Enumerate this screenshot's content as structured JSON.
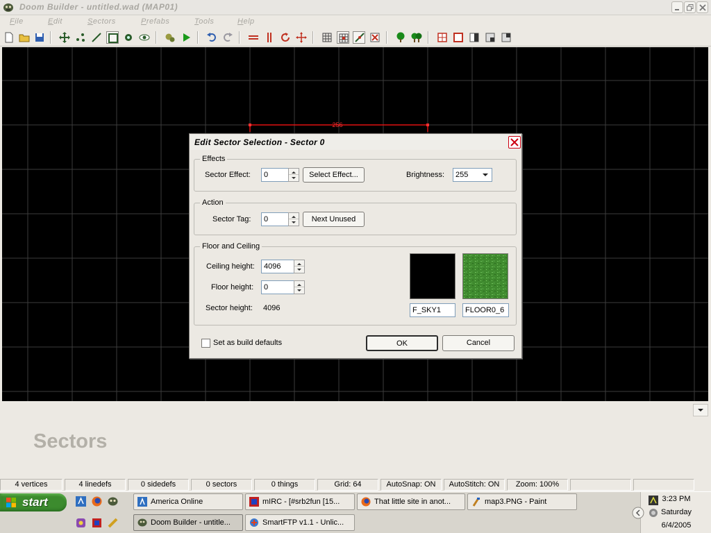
{
  "window": {
    "title": "Doom Builder - untitled.wad (MAP01)"
  },
  "menu": [
    {
      "u": "F",
      "rest": "ile"
    },
    {
      "u": "E",
      "rest": "dit"
    },
    {
      "u": "S",
      "rest": "ectors"
    },
    {
      "u": "P",
      "rest": "refabs"
    },
    {
      "u": "T",
      "rest": "ools"
    },
    {
      "u": "H",
      "rest": "elp"
    }
  ],
  "map": {
    "line_length_label": "256"
  },
  "dialog": {
    "title": "Edit Sector Selection - Sector 0",
    "effects": {
      "legend": "Effects",
      "sector_effect_label": "Sector Effect:",
      "sector_effect_value": "0",
      "select_effect_button": "Select Effect...",
      "brightness_label": "Brightness:",
      "brightness_value": "255"
    },
    "action": {
      "legend": "Action",
      "sector_tag_label": "Sector Tag:",
      "sector_tag_value": "0",
      "next_unused_button": "Next Unused"
    },
    "floor_ceiling": {
      "legend": "Floor and Ceiling",
      "ceiling_height_label": "Ceiling height:",
      "ceiling_height_value": "4096",
      "floor_height_label": "Floor height:",
      "floor_height_value": "0",
      "sector_height_label": "Sector height:",
      "sector_height_value": "4096",
      "ceiling_texture": "F_SKY1",
      "floor_texture": "FLOOR0_6"
    },
    "build_defaults_label": "Set as build defaults",
    "ok_button": "OK",
    "cancel_button": "Cancel"
  },
  "info_panel": {
    "title": "Sectors"
  },
  "status": {
    "vertices": "4 vertices",
    "linedefs": "4 linedefs",
    "sidedefs": "0 sidedefs",
    "sectors": "0 sectors",
    "things": "0 things",
    "grid": "Grid: 64",
    "autosnap": "AutoSnap: ON",
    "autostitch": "AutoStitch: ON",
    "zoom": "Zoom: 100%"
  },
  "taskbar": {
    "start": "start",
    "tasks": [
      "America  Online",
      "mIRC - [#srb2fun [15...",
      "That little site in anot...",
      "map3.PNG - Paint",
      "Doom Builder - untitle...",
      "SmartFTP v1.1 - Unlic..."
    ],
    "clock": {
      "time": "3:23 PM",
      "day": "Saturday",
      "date": "6/4/2005"
    }
  }
}
